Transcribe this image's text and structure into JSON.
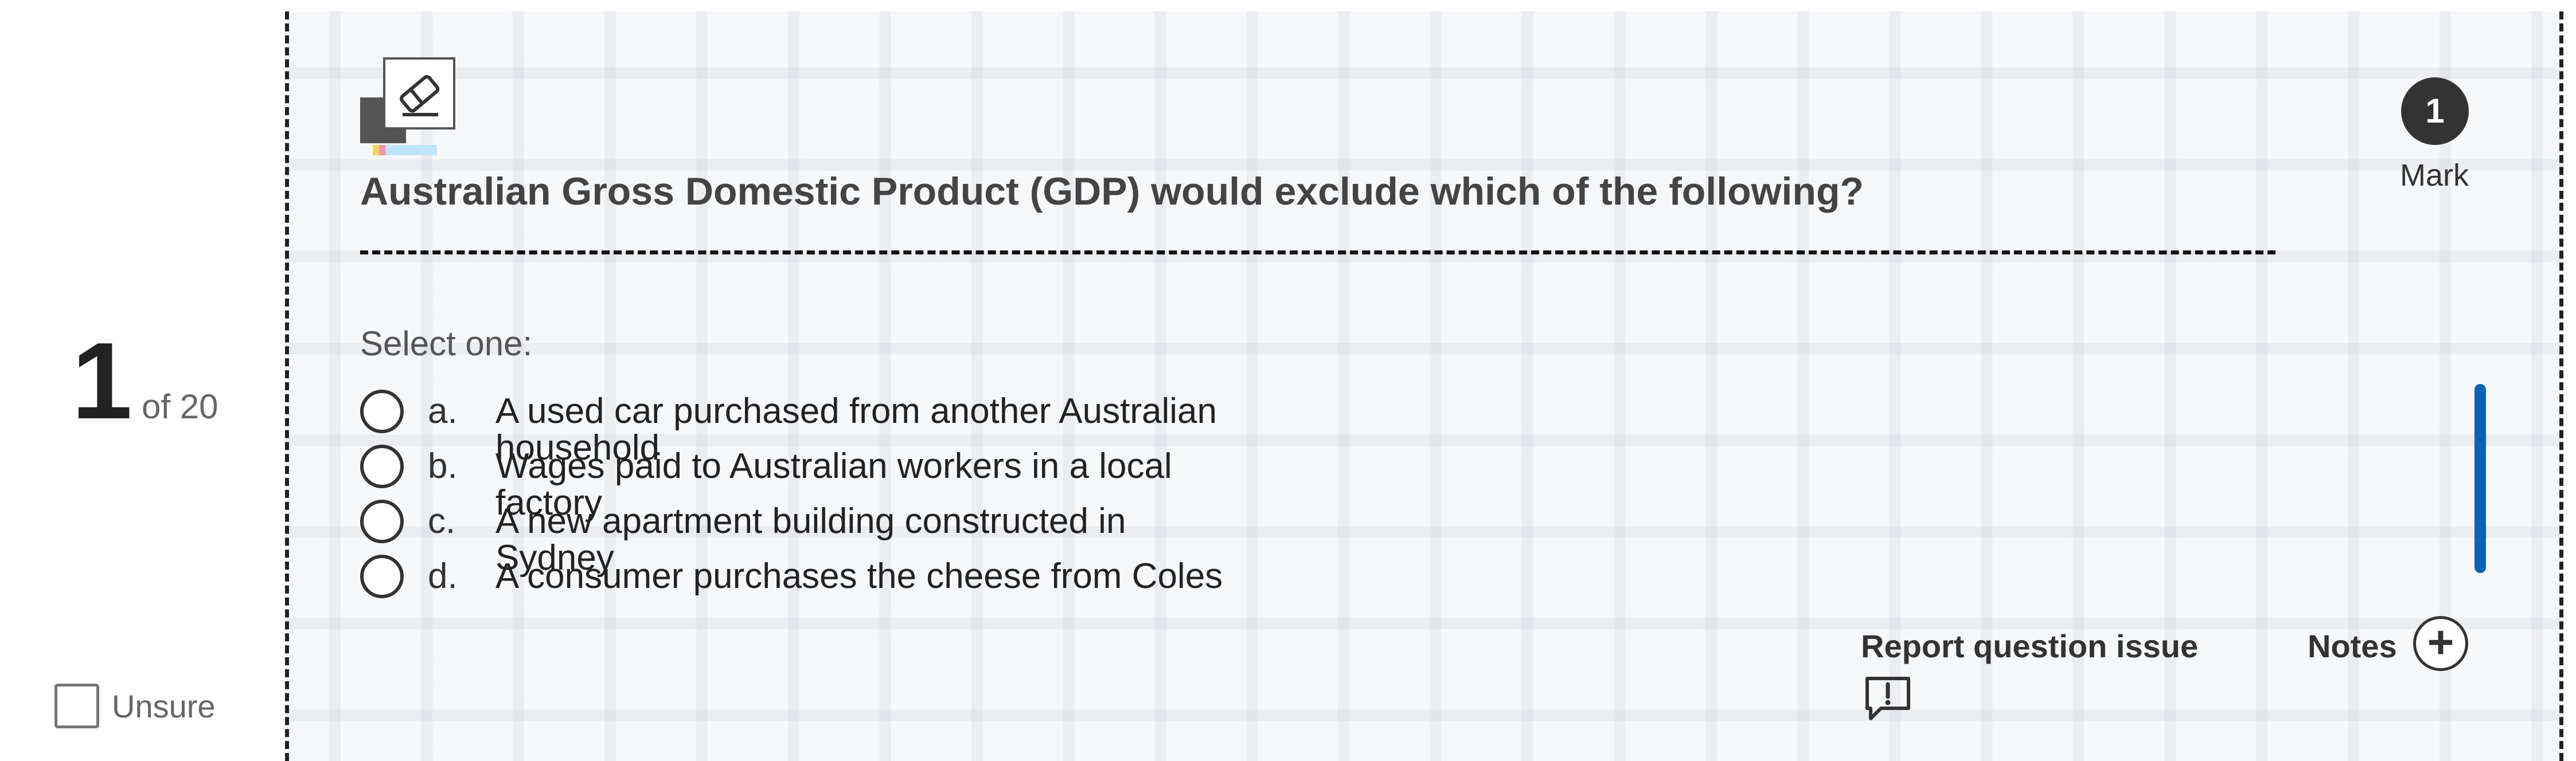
{
  "question_nav": {
    "number": "1",
    "of_label": "of 20",
    "unsure_label": "Unsure"
  },
  "question": {
    "text": "Australian Gross Domestic Product (GDP) would exclude which of the following?",
    "instruction": "Select one:",
    "options": [
      {
        "letter": "a.",
        "text": "A used car purchased from another Australian household"
      },
      {
        "letter": "b.",
        "text": "Wages paid to Australian workers in a local factory"
      },
      {
        "letter": "c.",
        "text": "A new apartment building constructed in Sydney"
      },
      {
        "letter": "d.",
        "text": "A consumer purchases the cheese from Coles"
      }
    ]
  },
  "mark": {
    "value": "1",
    "label": "Mark"
  },
  "actions": {
    "report_label": "Report question issue",
    "notes_label": "Notes",
    "notes_icon_glyph": "+"
  },
  "icons": {
    "tool": "eraser-icon",
    "report": "report-issue-icon",
    "notes": "add-note-icon"
  },
  "colors": {
    "accent": "#0b64b0",
    "badge": "#333333"
  }
}
